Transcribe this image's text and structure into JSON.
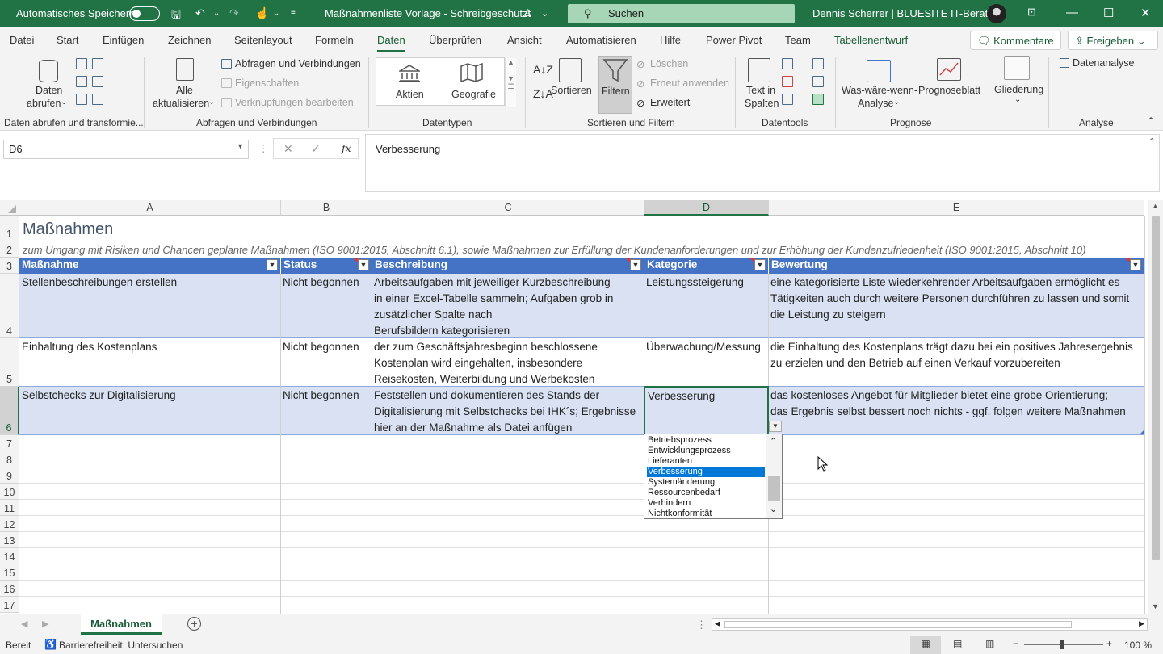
{
  "titlebar": {
    "autosave_label": "Automatisches Speichern",
    "doc_title": "Maßnahmenliste Vorlage  -  Schreibgeschützt",
    "search_placeholder": "Suchen",
    "user": "Dennis Scherrer | BLUESITE IT-Beratung",
    "accent": "#217346"
  },
  "menu": {
    "items": [
      "Datei",
      "Start",
      "Einfügen",
      "Zeichnen",
      "Seitenlayout",
      "Formeln",
      "Daten",
      "Überprüfen",
      "Ansicht",
      "Automatisieren",
      "Hilfe",
      "Power Pivot",
      "Team",
      "Tabellenentwurf"
    ],
    "active": "Daten",
    "comments_label": "Kommentare",
    "share_label": "Freigeben"
  },
  "ribbon": {
    "get_data_1": "Daten",
    "get_data_2": "abrufen",
    "group_get": "Daten abrufen und transformie...",
    "refresh_1": "Alle",
    "refresh_2": "aktualisieren",
    "queries": "Abfragen und Verbindungen",
    "properties": "Eigenschaften",
    "edit_links": "Verknüpfungen bearbeiten",
    "group_queries": "Abfragen und Verbindungen",
    "stocks": "Aktien",
    "geography": "Geografie",
    "group_types": "Datentypen",
    "sort": "Sortieren",
    "filter": "Filtern",
    "clear": "Löschen",
    "reapply": "Erneut anwenden",
    "advanced": "Erweitert",
    "group_sort": "Sortieren und Filtern",
    "text_to_cols_1": "Text in",
    "text_to_cols_2": "Spalten",
    "group_tools": "Datentools",
    "whatif_1": "Was-wäre-wenn-",
    "whatif_2": "Analyse",
    "forecast": "Prognoseblatt",
    "group_forecast": "Prognose",
    "outline": "Gliederung",
    "analysis": "Datenanalyse",
    "group_analysis": "Analyse"
  },
  "formula_bar": {
    "name_box": "D6",
    "fx": "fx",
    "content": "Verbesserung"
  },
  "columns": [
    "A",
    "B",
    "C",
    "D",
    "E"
  ],
  "rows": [
    "1",
    "2",
    "3",
    "4",
    "5",
    "6",
    "7",
    "8",
    "9",
    "10",
    "11",
    "12",
    "13",
    "14",
    "15",
    "16",
    "17"
  ],
  "sheet": {
    "title": "Maßnahmen",
    "subtitle": "zum Umgang mit Risiken und Chancen geplante Maßnahmen (ISO 9001:2015, Abschnitt 6.1), sowie Maßnahmen zur Erfüllung der Kundenanforderungen und zur Erhöhung der Kundenzufriedenheit (ISO 9001:2015, Abschnitt 10)",
    "headers": [
      "Maßnahme",
      "Status",
      "Beschreibung",
      "Kategorie",
      "Bewertung"
    ],
    "data": [
      [
        "Stellenbeschreibungen erstellen",
        "Nicht begonnen",
        "Arbeitsaufgaben mit jeweiliger Kurzbeschreibung\nin einer Excel-Tabelle sammeln; Aufgaben grob in\nzusätzlicher Spalte nach\nBerufsbildern kategorisieren",
        "Leistungssteigerung",
        "eine kategorisierte Liste wiederkehrender Arbeitsaufgaben ermöglicht es\nTätigkeiten auch durch weitere Personen durchführen zu lassen und somit\ndie Leistung zu steigern"
      ],
      [
        "Einhaltung des Kostenplans",
        "Nicht begonnen",
        "der zum Geschäftsjahresbeginn beschlossene\nKostenplan wird eingehalten, insbesondere\nReisekosten, Weiterbildung und Werbekosten",
        "Überwachung/Messung",
        "die Einhaltung des Kostenplans trägt dazu bei ein positives Jahresergebnis\nzu erzielen und den Betrieb auf einen Verkauf vorzubereiten"
      ],
      [
        "Selbstchecks zur Digitalisierung",
        "Nicht begonnen",
        "Feststellen und dokumentieren des Stands der\nDigitalisierung mit Selbstchecks bei IHK´s; Ergebnisse\nhier an der Maßnahme als Datei anfügen",
        "Verbesserung",
        "das kostenloses Angebot für Mitglieder bietet eine grobe Orientierung;\ndas Ergebnis selbst bessert noch nichts - ggf. folgen weitere Maßnahmen"
      ]
    ],
    "header_color": "#4472c4",
    "band_color": "#d9e1f2"
  },
  "dropdown": {
    "items": [
      "Betriebsprozess",
      "Entwicklungsprozess",
      "Lieferanten",
      "Verbesserung",
      "Systemänderung",
      "Ressourcenbedarf",
      "Verhindern",
      "Nichtkonformität"
    ],
    "selected": "Verbesserung"
  },
  "sheet_tab": "Maßnahmen",
  "status": {
    "ready": "Bereit",
    "accessibility": "Barrierefreiheit: Untersuchen",
    "zoom": "100 %"
  }
}
